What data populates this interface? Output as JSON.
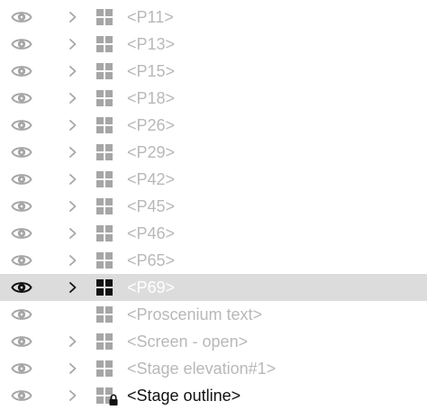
{
  "colors": {
    "icon_gray": "#a6a6a6",
    "icon_dark": "#111111",
    "label_dim": "#b8b8b8",
    "label_selected": "#ffffff",
    "label_active": "#111111",
    "selected_row_bg": "#dcdcdc"
  },
  "layers": [
    {
      "label": "<P11>",
      "visible_icon": "eye-icon",
      "expandable": true,
      "type_icon": "grid-icon",
      "locked": false,
      "selected": false,
      "active": false
    },
    {
      "label": "<P13>",
      "visible_icon": "eye-icon",
      "expandable": true,
      "type_icon": "grid-icon",
      "locked": false,
      "selected": false,
      "active": false
    },
    {
      "label": "<P15>",
      "visible_icon": "eye-icon",
      "expandable": true,
      "type_icon": "grid-icon",
      "locked": false,
      "selected": false,
      "active": false
    },
    {
      "label": "<P18>",
      "visible_icon": "eye-icon",
      "expandable": true,
      "type_icon": "grid-icon",
      "locked": false,
      "selected": false,
      "active": false
    },
    {
      "label": "<P26>",
      "visible_icon": "eye-icon",
      "expandable": true,
      "type_icon": "grid-icon",
      "locked": false,
      "selected": false,
      "active": false
    },
    {
      "label": "<P29>",
      "visible_icon": "eye-icon",
      "expandable": true,
      "type_icon": "grid-icon",
      "locked": false,
      "selected": false,
      "active": false
    },
    {
      "label": "<P42>",
      "visible_icon": "eye-icon",
      "expandable": true,
      "type_icon": "grid-icon",
      "locked": false,
      "selected": false,
      "active": false
    },
    {
      "label": "<P45>",
      "visible_icon": "eye-icon",
      "expandable": true,
      "type_icon": "grid-icon",
      "locked": false,
      "selected": false,
      "active": false
    },
    {
      "label": "<P46>",
      "visible_icon": "eye-icon",
      "expandable": true,
      "type_icon": "grid-icon",
      "locked": false,
      "selected": false,
      "active": false
    },
    {
      "label": "<P65>",
      "visible_icon": "eye-icon",
      "expandable": true,
      "type_icon": "grid-icon",
      "locked": false,
      "selected": false,
      "active": false
    },
    {
      "label": "<P69>",
      "visible_icon": "eye-icon",
      "expandable": true,
      "type_icon": "grid-icon",
      "locked": false,
      "selected": true,
      "active": false
    },
    {
      "label": "<Proscenium text>",
      "visible_icon": "eye-icon",
      "expandable": false,
      "type_icon": "grid-icon",
      "locked": false,
      "selected": false,
      "active": false
    },
    {
      "label": "<Screen - open>",
      "visible_icon": "eye-icon",
      "expandable": true,
      "type_icon": "grid-icon",
      "locked": false,
      "selected": false,
      "active": false
    },
    {
      "label": "<Stage elevation#1>",
      "visible_icon": "eye-icon",
      "expandable": true,
      "type_icon": "grid-icon",
      "locked": false,
      "selected": false,
      "active": false
    },
    {
      "label": "<Stage outline>",
      "visible_icon": "eye-icon",
      "expandable": true,
      "type_icon": "grid-icon",
      "locked": true,
      "selected": false,
      "active": true
    }
  ]
}
